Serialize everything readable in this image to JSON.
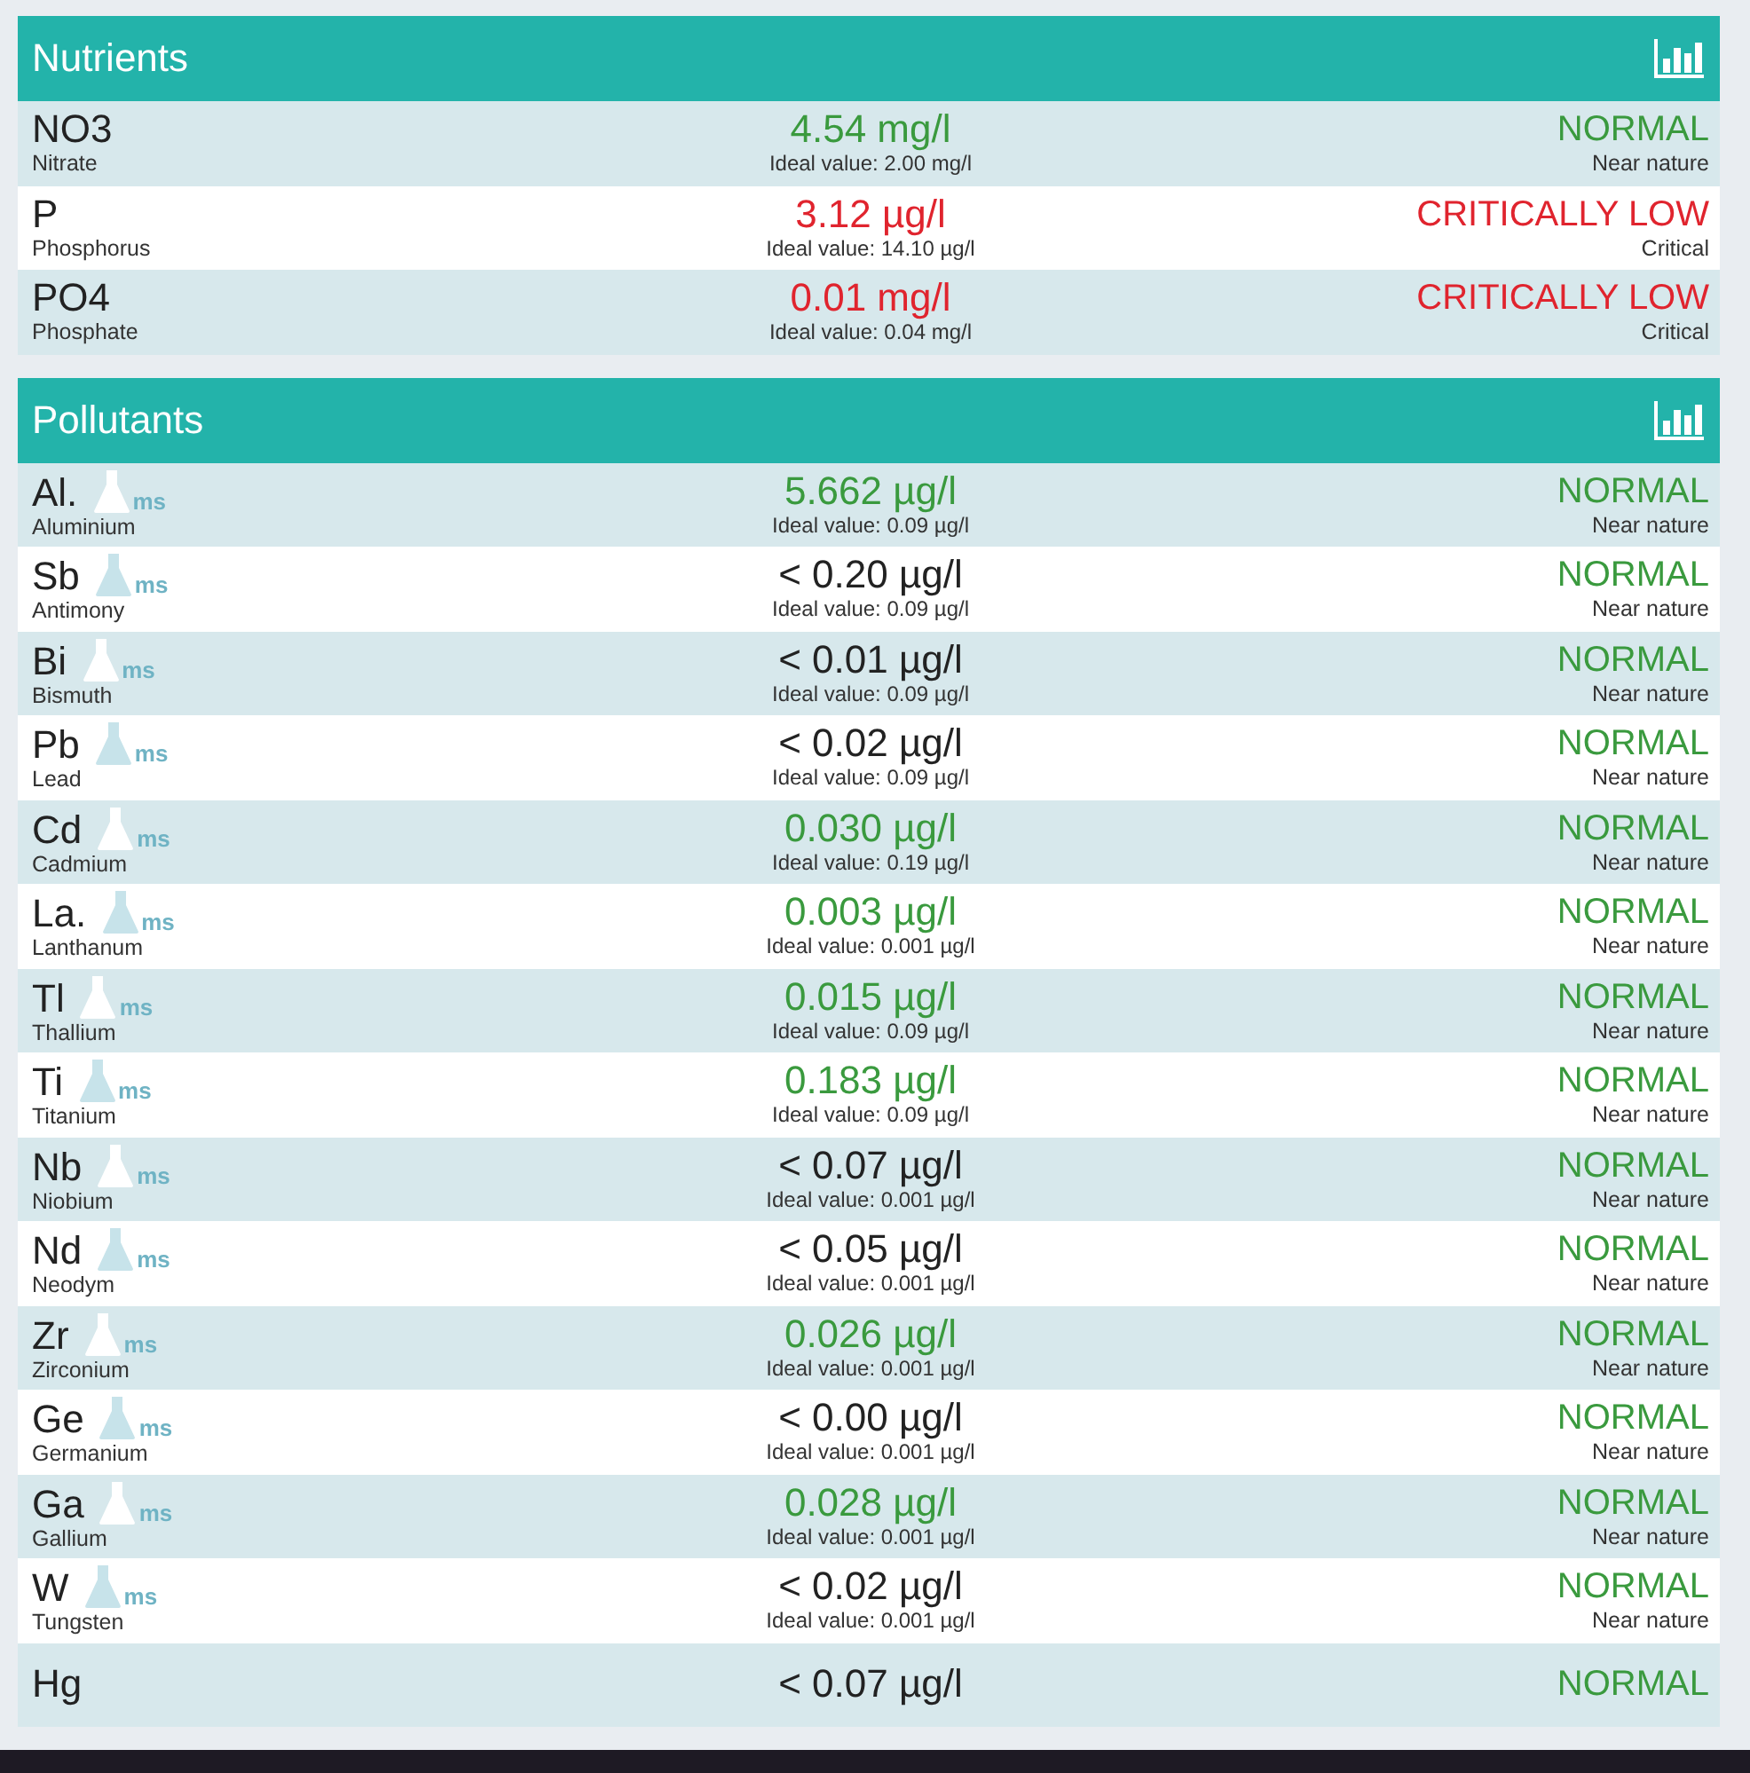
{
  "sections": [
    {
      "title": "Nutrients",
      "rows": [
        {
          "symbol": "NO3",
          "name": "Nitrate",
          "value": {
            "text": "4.54 mg/l",
            "color": "#3a9a3e"
          },
          "ideal": "Ideal value: 2.00 mg/l",
          "status": {
            "text": "NORMAL",
            "color": "#3a9a3e"
          },
          "status_note": "Near nature"
        },
        {
          "symbol": "P",
          "name": "Phosphorus",
          "value": {
            "text": "3.12 µg/l",
            "color": "#e0242e"
          },
          "ideal": "Ideal value: 14.10 µg/l",
          "status": {
            "text": "CRITICALLY LOW",
            "color": "#e0242e"
          },
          "status_note": "Critical"
        },
        {
          "symbol": "PO4",
          "name": "Phosphate",
          "value": {
            "text": "0.01 mg/l",
            "color": "#e0242e"
          },
          "ideal": "Ideal value: 0.04 mg/l",
          "status": {
            "text": "CRITICALLY LOW",
            "color": "#e0242e"
          },
          "status_note": "Critical"
        }
      ]
    },
    {
      "title": "Pollutants",
      "rows": [
        {
          "symbol": "Al.",
          "badge": "ms",
          "name": "Aluminium",
          "value": {
            "text": "5.662 µg/l",
            "color": "#3a9a3e"
          },
          "ideal": "Ideal value: 0.09 µg/l",
          "status": {
            "text": "NORMAL",
            "color": "#3a9a3e"
          },
          "status_note": "Near nature"
        },
        {
          "symbol": "Sb",
          "badge": "ms",
          "name": "Antimony",
          "value": {
            "text": "< 0.20 µg/l",
            "color": "#222222"
          },
          "ideal": "Ideal value: 0.09 µg/l",
          "status": {
            "text": "NORMAL",
            "color": "#3a9a3e"
          },
          "status_note": "Near nature"
        },
        {
          "symbol": "Bi",
          "badge": "ms",
          "name": "Bismuth",
          "value": {
            "text": "< 0.01 µg/l",
            "color": "#222222"
          },
          "ideal": "Ideal value: 0.09 µg/l",
          "status": {
            "text": "NORMAL",
            "color": "#3a9a3e"
          },
          "status_note": "Near nature"
        },
        {
          "symbol": "Pb",
          "badge": "ms",
          "name": "Lead",
          "value": {
            "text": "< 0.02 µg/l",
            "color": "#222222"
          },
          "ideal": "Ideal value: 0.09 µg/l",
          "status": {
            "text": "NORMAL",
            "color": "#3a9a3e"
          },
          "status_note": "Near nature"
        },
        {
          "symbol": "Cd",
          "badge": "ms",
          "name": "Cadmium",
          "value": {
            "text": "0.030 µg/l",
            "color": "#3a9a3e"
          },
          "ideal": "Ideal value: 0.19 µg/l",
          "status": {
            "text": "NORMAL",
            "color": "#3a9a3e"
          },
          "status_note": "Near nature"
        },
        {
          "symbol": "La.",
          "badge": "ms",
          "name": "Lanthanum",
          "value": {
            "text": "0.003 µg/l",
            "color": "#3a9a3e"
          },
          "ideal": "Ideal value: 0.001 µg/l",
          "status": {
            "text": "NORMAL",
            "color": "#3a9a3e"
          },
          "status_note": "Near nature"
        },
        {
          "symbol": "Tl",
          "badge": "ms",
          "name": "Thallium",
          "value": {
            "text": "0.015 µg/l",
            "color": "#3a9a3e"
          },
          "ideal": "Ideal value: 0.09 µg/l",
          "status": {
            "text": "NORMAL",
            "color": "#3a9a3e"
          },
          "status_note": "Near nature"
        },
        {
          "symbol": "Ti",
          "badge": "ms",
          "name": "Titanium",
          "value": {
            "text": "0.183 µg/l",
            "color": "#3a9a3e"
          },
          "ideal": "Ideal value: 0.09 µg/l",
          "status": {
            "text": "NORMAL",
            "color": "#3a9a3e"
          },
          "status_note": "Near nature"
        },
        {
          "symbol": "Nb",
          "badge": "ms",
          "name": "Niobium",
          "value": {
            "text": "< 0.07 µg/l",
            "color": "#222222"
          },
          "ideal": "Ideal value: 0.001 µg/l",
          "status": {
            "text": "NORMAL",
            "color": "#3a9a3e"
          },
          "status_note": "Near nature"
        },
        {
          "symbol": "Nd",
          "badge": "ms",
          "name": "Neodym",
          "value": {
            "text": "< 0.05 µg/l",
            "color": "#222222"
          },
          "ideal": "Ideal value: 0.001 µg/l",
          "status": {
            "text": "NORMAL",
            "color": "#3a9a3e"
          },
          "status_note": "Near nature"
        },
        {
          "symbol": "Zr",
          "badge": "ms",
          "name": "Zirconium",
          "value": {
            "text": "0.026 µg/l",
            "color": "#3a9a3e"
          },
          "ideal": "Ideal value: 0.001 µg/l",
          "status": {
            "text": "NORMAL",
            "color": "#3a9a3e"
          },
          "status_note": "Near nature"
        },
        {
          "symbol": "Ge",
          "badge": "ms",
          "name": "Germanium",
          "value": {
            "text": "< 0.00 µg/l",
            "color": "#222222"
          },
          "ideal": "Ideal value: 0.001 µg/l",
          "status": {
            "text": "NORMAL",
            "color": "#3a9a3e"
          },
          "status_note": "Near nature"
        },
        {
          "symbol": "Ga",
          "badge": "ms",
          "name": "Gallium",
          "value": {
            "text": "0.028 µg/l",
            "color": "#3a9a3e"
          },
          "ideal": "Ideal value: 0.001 µg/l",
          "status": {
            "text": "NORMAL",
            "color": "#3a9a3e"
          },
          "status_note": "Near nature"
        },
        {
          "symbol": "W",
          "badge": "ms",
          "name": "Tungsten",
          "value": {
            "text": "< 0.02 µg/l",
            "color": "#222222"
          },
          "ideal": "Ideal value: 0.001 µg/l",
          "status": {
            "text": "NORMAL",
            "color": "#3a9a3e"
          },
          "status_note": "Near nature"
        },
        {
          "symbol": "Hg",
          "value": {
            "text": "< 0.07 µg/l",
            "color": "#222222"
          },
          "status": {
            "text": "NORMAL",
            "color": "#3a9a3e"
          }
        }
      ]
    }
  ]
}
